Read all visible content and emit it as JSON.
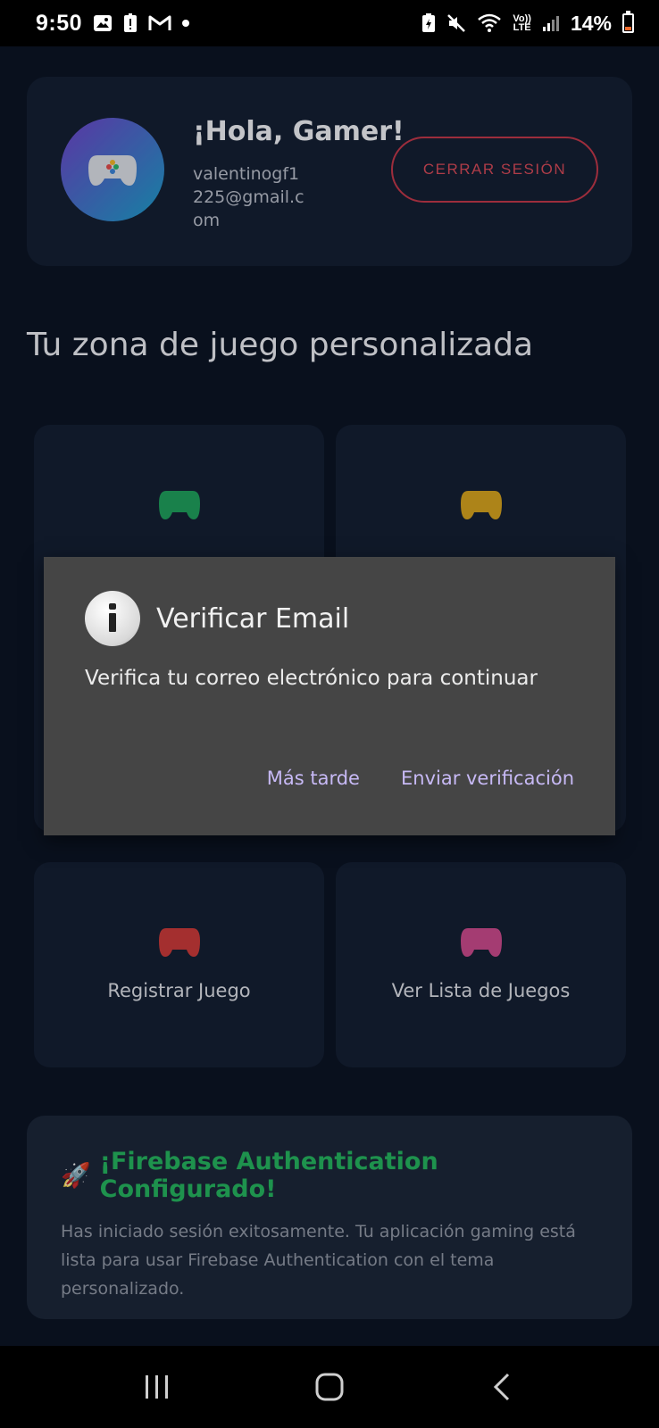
{
  "status_bar": {
    "time": "9:50",
    "volte_line1": "Vo))",
    "volte_line2": "LTE",
    "battery_percent": "14%"
  },
  "profile": {
    "greeting": "¡Hola, Gamer!",
    "email": "valentinogf1225@gmail.com",
    "logout_label": "CERRAR SESIÓN"
  },
  "section_title": "Tu zona de juego personalizada",
  "grid": {
    "registrar_label": "Registrar Juego",
    "lista_label": "Ver Lista de Juegos"
  },
  "info_card": {
    "emoji": "🚀",
    "title": "¡Firebase Authentication Configurado!",
    "text": "Has iniciado sesión exitosamente. Tu aplicación gaming está lista para usar Firebase Authentication con el tema personalizado."
  },
  "dialog": {
    "title": "Verificar Email",
    "message": "Verifica tu correo electrónico para continuar",
    "later_label": "Más tarde",
    "send_label": "Enviar verificación"
  },
  "colors": {
    "background": "#0b1424",
    "card": "#141f33",
    "logout_border": "#c0384a",
    "pad_green": "#1f9e5c",
    "pad_yellow": "#d4a21f",
    "pad_red": "#c93a3a",
    "pad_pink": "#c94a8c",
    "dialog_bg": "#454545",
    "dialog_action": "#c7b9f5",
    "info_title": "#25b35e"
  }
}
